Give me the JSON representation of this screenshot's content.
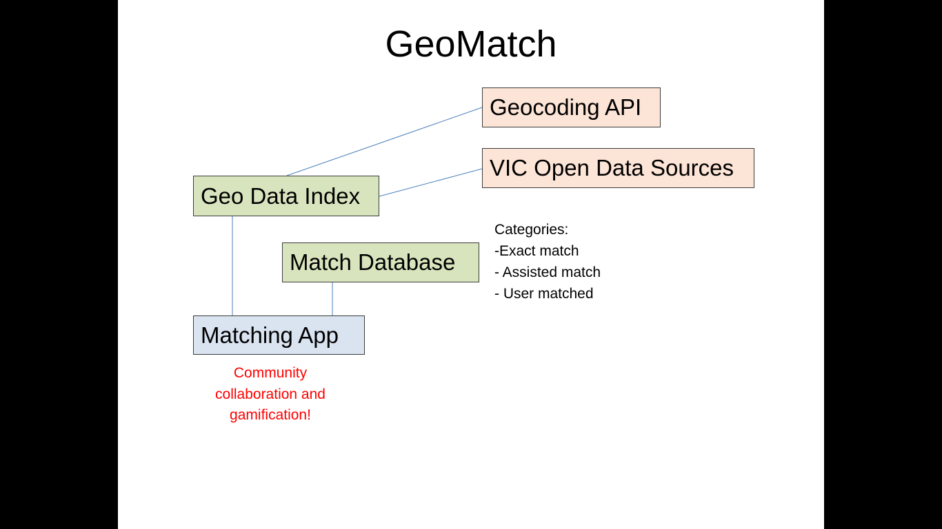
{
  "title": "GeoMatch",
  "nodes": {
    "geocoding_api": "Geocoding API",
    "vic_open_data": "VIC Open Data Sources",
    "geo_data_index": "Geo Data Index",
    "match_database": "Match Database",
    "matching_app": "Matching App"
  },
  "categories": {
    "heading": "Categories:",
    "items": [
      "-Exact match",
      "- Assisted match",
      "- User matched"
    ]
  },
  "note": {
    "lines": [
      "Community",
      "collaboration and",
      "gamification!"
    ]
  },
  "colors": {
    "green_box": "#d8e4bd",
    "peach_box": "#fce4d6",
    "blue_box": "#dae3f0",
    "connector": "#4a7ebb",
    "note_text": "#ff0000"
  }
}
